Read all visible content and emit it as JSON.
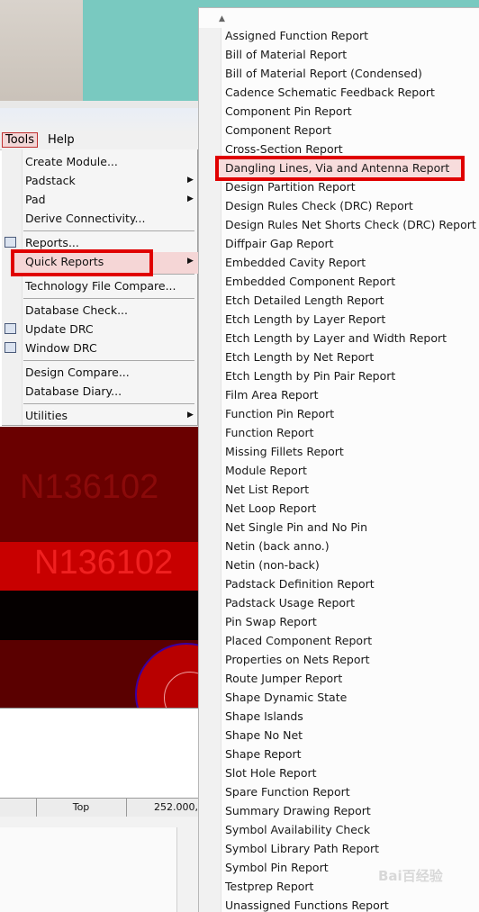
{
  "menubar": {
    "tools": "Tools",
    "help": "Help"
  },
  "tools_menu": {
    "items": [
      {
        "label": "Create Module..."
      },
      {
        "label": "Padstack"
      },
      {
        "label": "Pad"
      },
      {
        "label": "Derive Connectivity..."
      },
      {
        "label": "Reports..."
      },
      {
        "label": "Quick Reports"
      },
      {
        "label": "Technology File Compare..."
      },
      {
        "label": "Database Check..."
      },
      {
        "label": "Update DRC"
      },
      {
        "label": "Window DRC"
      },
      {
        "label": "Design Compare..."
      },
      {
        "label": "Database Diary..."
      },
      {
        "label": "Utilities"
      }
    ]
  },
  "canvas": {
    "net_label_1": "N136102",
    "net_label_2": "N136102"
  },
  "statusbar": {
    "layer": "Top",
    "coords": "252.000,"
  },
  "quick_reports": {
    "items": [
      "Assigned Function Report",
      "Bill of Material Report",
      "Bill of Material Report (Condensed)",
      "Cadence Schematic Feedback Report",
      "Component Pin Report",
      "Component Report",
      "Cross-Section Report",
      "Dangling Lines, Via and Antenna Report",
      "Design Partition Report",
      "Design Rules Check (DRC) Report",
      "Design Rules Net Shorts Check (DRC) Report",
      "Diffpair Gap Report",
      "Embedded Cavity Report",
      "Embedded Component Report",
      "Etch Detailed Length Report",
      "Etch Length by Layer Report",
      "Etch Length by Layer and Width Report",
      "Etch Length by Net Report",
      "Etch Length by Pin Pair Report",
      "Film Area Report",
      "Function Pin Report",
      "Function Report",
      "Missing Fillets Report",
      "Module Report",
      "Net List Report",
      "Net Loop Report",
      "Net Single Pin and No Pin",
      "Netin (back anno.)",
      "Netin (non-back)",
      "Padstack Definition Report",
      "Padstack Usage Report",
      "Pin Swap Report",
      "Placed Component Report",
      "Properties on Nets Report",
      "Route Jumper Report",
      "Shape Dynamic State",
      "Shape Islands",
      "Shape No Net",
      "Shape Report",
      "Slot Hole Report",
      "Spare Function Report",
      "Summary Drawing Report",
      "Symbol Availability Check",
      "Symbol Library Path Report",
      "Symbol Pin Report",
      "Testprep Report",
      "Unassigned Functions Report"
    ]
  },
  "watermark": "Bai百经验",
  "colors": {
    "highlight_box": "#e00000",
    "pcb_bg": "#6a0000",
    "pcb_stripe": "#c80000",
    "menu_hover": "#f5d6d6"
  }
}
